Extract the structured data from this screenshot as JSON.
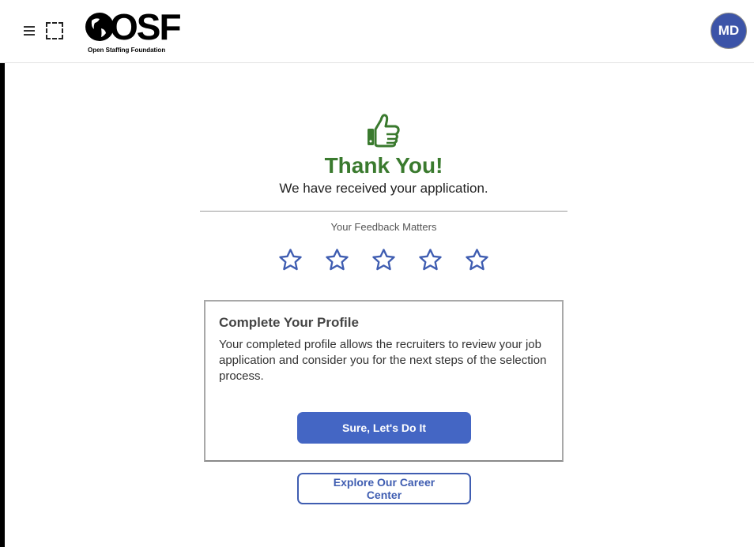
{
  "header": {
    "logo_text": "OSF",
    "logo_subtitle": "Open Staffing Foundation",
    "avatar_initials": "MD"
  },
  "main": {
    "thanks_title": "Thank You!",
    "received_text": "We have received your application.",
    "feedback_label": "Your Feedback Matters",
    "rating": {
      "max": 5,
      "selected": 0
    }
  },
  "profile_card": {
    "title": "Complete Your Profile",
    "body": "Your completed profile allows the recruiters to review your job application and consider you for the next steps of the selection process.",
    "button_label": "Sure, Let's Do It"
  },
  "career_button_label": "Explore Our Career Center",
  "colors": {
    "accent_blue": "#4466c4",
    "success_green": "#3a7a2e",
    "avatar_bg": "#3c54a8"
  }
}
